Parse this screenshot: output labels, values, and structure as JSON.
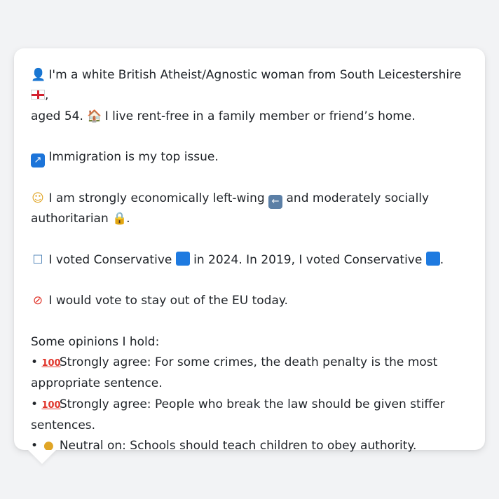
{
  "message": {
    "intro_line_1": "I'm a white British Atheist/Agnostic woman from South Leicestershire",
    "intro_line_1_end": ",",
    "intro_line_2": "aged 54.",
    "intro_line_2_cont": "I live rent-free in a family member or friend’s home.",
    "top_issue": "Immigration is my top issue.",
    "politics_1": "I am strongly economically left-wing",
    "politics_2": "and moderately socially",
    "politics_3": "authoritarian",
    "politics_end": ".",
    "vote_1": "I voted Conservative",
    "vote_2": "in 2024. In 2019, I voted Conservative",
    "vote_end": ".",
    "eu": "I would vote to stay out of the EU today.",
    "opinions_heading": "Some opinions I hold:",
    "opinions": [
      {
        "bullet": "•",
        "stance": "Strongly agree: For some crimes, the death penalty is the most appropriate sentence."
      },
      {
        "bullet": "•",
        "stance": "Strongly agree: People who break the law should be given stiffer sentences."
      },
      {
        "bullet": "•",
        "stance": "Neutral on: Schools should teach children to obey authority."
      }
    ]
  },
  "icons": {
    "person": "person-silhouette-icon",
    "flag": "england-flag-icon",
    "house": "house-icon",
    "immigration": "passport-control-icon",
    "thinking": "thinking-face-icon",
    "left_arrow": "left-arrow-icon",
    "lock": "lock-icon",
    "ballot": "ballot-box-icon",
    "conservative": "blue-square-icon",
    "no_entry": "prohibited-icon",
    "hundred": "hundred-points-icon",
    "neutral": "neutral-face-icon"
  },
  "colors": {
    "background": "#f2f3f5",
    "bubble": "#ffffff",
    "text": "#1f2328",
    "conservative_blue": "#1e7ae0",
    "icon_blue": "#1c74d9"
  }
}
